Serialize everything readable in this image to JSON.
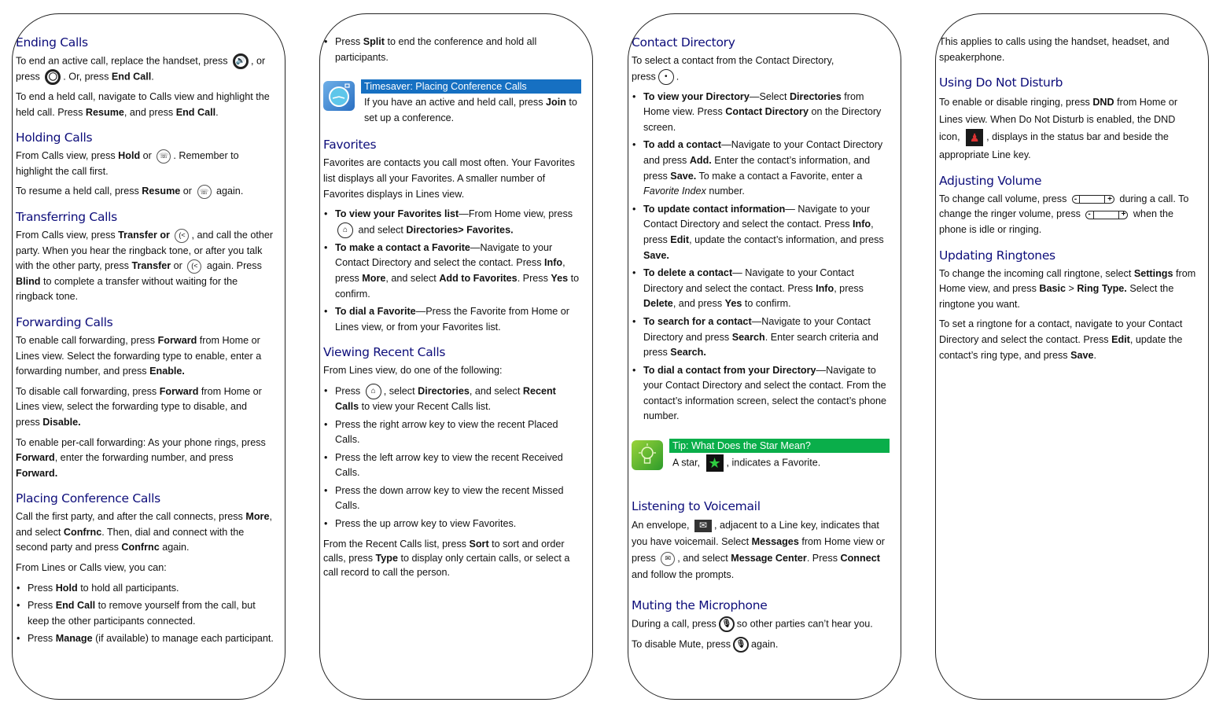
{
  "panel1": {
    "ending_calls": {
      "title": "Ending Calls",
      "p1_a": "To end an active call, replace the handset, press",
      "p1_b": ", or",
      "p1_c": "press",
      "p1_d": ". Or, press",
      "p1_bold1": "End Call",
      "p1_end": ".",
      "p2_a": "To end a held call, navigate to Calls view and highlight the held call. Press",
      "p2_bold1": "Resume",
      "p2_b": ", and press",
      "p2_bold2": "End Call",
      "p2_end": "."
    },
    "holding_calls": {
      "title": "Holding Calls",
      "p1_a": "From Calls view, press",
      "p1_bold": "Hold",
      "p1_b": "or",
      "p1_c": ". Remember to highlight the call first.",
      "p2_a": "To resume a held call, press",
      "p2_bold": "Resume",
      "p2_b": "or",
      "p2_c": "again."
    },
    "transferring_calls": {
      "title": "Transferring Calls",
      "a": "From Calls view, press",
      "bold1": "Transfer or",
      "b": ", and call the other party. When you hear the ringback tone, or after you talk with the other party, press",
      "bold2": "Transfer",
      "c": "or",
      "d": "again. Press",
      "bold3": "Blind",
      "e": "to complete a transfer without waiting for the ringback tone."
    },
    "forwarding_calls": {
      "title": "Forwarding Calls",
      "p1_a": "To enable call forwarding, press",
      "p1_bold1": "Forward",
      "p1_b": "from Home or Lines view. Select the forwarding type to enable, enter a forwarding number, and press",
      "p1_bold2": "Enable",
      "p2_a": "To disable call forwarding, press",
      "p2_bold1": "Forward",
      "p2_b": "from Home or Lines view, select the forwarding type to disable, and press",
      "p2_bold2": "Disable",
      "p3_a": "To enable per-call forwarding: As your phone rings, press",
      "p3_bold1": "Forward",
      "p3_b": ", enter the forwarding number, and press",
      "p3_bold2": "Forward",
      "period": "."
    },
    "conference_calls": {
      "title": "Placing Conference Calls",
      "p1_a": "Call the first party, and after the call connects, press",
      "p1_bold1": "More",
      "p1_b": ", and select",
      "p1_bold2": "Confrnc",
      "p1_c": ". Then, dial and connect with the second party and press",
      "p1_bold3": "Confrnc",
      "p1_d": "again.",
      "p2": "From Lines or Calls view, you can:",
      "items": [
        {
          "a": "Press",
          "bold": "Hold",
          "b": "to hold all participants."
        },
        {
          "a": "Press",
          "bold": "End Call",
          "b": "to remove yourself from the call, but keep the other participants connected."
        },
        {
          "a": "Press",
          "bold": "Manage",
          "b": "(if available) to manage each participant."
        }
      ]
    }
  },
  "panel2": {
    "split_item": {
      "a": "Press",
      "bold": "Split",
      "b": "to end the conference and hold all participants."
    },
    "timesaver": {
      "title": "Timesaver: Placing Conference Calls",
      "a": "If you have an active and held call, press",
      "bold": "Join",
      "b": "to set up a conference."
    },
    "favorites": {
      "title": "Favorites",
      "intro": "Favorites are contacts you call most often. Your Favorites list displays all your Favorites.  A smaller number of Favorites displays in Lines view.",
      "item1_bold": "To view your Favorites list",
      "item1_a": "—From Home view, press",
      "item1_b": "and select",
      "item1_bold2": "Directories> Favorites",
      "item2_bold": "To make a contact a Favorite",
      "item2_a": "—Navigate to your Contact Directory and select the contact. Press",
      "item2_bold2": "Info",
      "item2_b": ", press",
      "item2_bold3": "More",
      "item2_c": ", and select",
      "item2_bold4": "Add to Favorites",
      "item2_d": ".  Press",
      "item2_bold5": "Yes",
      "item2_e": "to confirm.",
      "item3_bold": "To dial a Favorite",
      "item3_a": "—Press the Favorite from Home or Lines view, or from your Favorites list."
    },
    "recent_calls": {
      "title": "Viewing Recent Calls",
      "intro": "From Lines view, do one of the following:",
      "item1_a": "Press",
      "item1_b": ", select",
      "item1_bold1": "Directories",
      "item1_c": ", and select",
      "item1_bold2": "Recent Calls",
      "item1_d": "to view your Recent Calls list.",
      "items": [
        "Press the right arrow key to view the recent Placed Calls.",
        "Press the left arrow key to view the recent Received Calls.",
        "Press the down arrow key to view the recent Missed Calls.",
        "Press the up arrow key to view Favorites."
      ],
      "outro_a": "From the Recent Calls list, press",
      "outro_bold1": "Sort",
      "outro_b": "to sort and order calls, press",
      "outro_bold2": "Type",
      "outro_c": "to display only certain calls, or select a call record to call the person."
    }
  },
  "panel3": {
    "contact_directory": {
      "title": "Contact Directory",
      "intro_a": "To select a contact from the Contact Directory,",
      "intro_b": "press",
      "intro_c": ".",
      "i1_bold": "To view your Directory",
      "i1_a": "—Select",
      "i1_bold2": "Directories",
      "i1_b": "from Home view. Press",
      "i1_bold3": "Contact Directory",
      "i1_c": "on the Directory screen.",
      "i2_bold": "To add a contact",
      "i2_a": "—Navigate to your Contact Directory and press",
      "i2_bold2": "Add.",
      "i2_b": "Enter the contact’s information, and press",
      "i2_bold3": "Save.",
      "i2_c": "To make a contact a Favorite, enter a",
      "i2_ital": "Favorite Index",
      "i2_d": "number.",
      "i3_bold": "To update contact information",
      "i3_a": "— Navigate to your Contact Directory and select the contact. Press",
      "i3_bold2": "Info",
      "i3_b": ", press",
      "i3_bold3": "Edit",
      "i3_c": ", update the contact’s information, and press",
      "i3_bold4": "Save",
      "i4_bold": "To delete a contact",
      "i4_a": "— Navigate to your Contact Directory and select the contact. Press",
      "i4_bold2": "Info",
      "i4_b": ", press",
      "i4_bold3": "Delete",
      "i4_c": ", and press",
      "i4_bold4": "Yes",
      "i4_d": "to confirm.",
      "i5_bold": "To search for a contact",
      "i5_a": "—Navigate to your Contact Directory and press",
      "i5_bold2": "Search",
      "i5_b": ". Enter search criteria and press",
      "i5_bold3": "Search",
      "i6_bold": "To dial a contact from your Directory",
      "i6_a": "—Navigate to your Contact Directory and select the contact. From the contact’s information screen, select the contact’s phone number.",
      "period": "."
    },
    "tip": {
      "title": "Tip: What Does the Star Mean?",
      "a": "A star,",
      "b": ", indicates a Favorite."
    },
    "voicemail": {
      "title": "Listening to Voicemail",
      "a": "An envelope,",
      "b": ", adjacent to a Line key, indicates that you have voicemail. Select",
      "bold1": "Messages",
      "c": "from Home view or press",
      "d": ", and select",
      "bold2": "Message Center",
      "e": ". Press",
      "bold3": "Connect",
      "f": "and follow the prompts."
    },
    "mute": {
      "title": "Muting the Microphone",
      "p1_a": "During a call, press",
      "p1_b": "so other parties can’t hear you.",
      "p2_a": "To disable Mute, press",
      "p2_b": "again."
    }
  },
  "panel4": {
    "intro": "This applies to calls using the handset, headset, and speakerphone.",
    "dnd": {
      "title": "Using Do Not Disturb",
      "a": "To enable or disable ringing, press",
      "bold": "DND",
      "b": "from Home or Lines view. When Do Not Disturb is enabled, the DND icon,",
      "c": ", displays in the status bar and beside the appropriate Line key."
    },
    "volume": {
      "title": "Adjusting Volume",
      "a": "To change call volume, press",
      "b": "during a call. To change the ringer volume, press",
      "c": "when the phone is idle or ringing."
    },
    "ringtones": {
      "title": "Updating Ringtones",
      "p1_a": "To change the incoming call ringtone, select",
      "p1_bold1": "Settings",
      "p1_b": "from Home view, and press",
      "p1_bold2": "Basic",
      "p1_gt": ">",
      "p1_bold3": "Ring Type.",
      "p1_c": "Select the ringtone you want.",
      "p2_a": "To set a ringtone for a contact, navigate to your Contact Directory and select the contact. Press",
      "p2_bold1": "Edit",
      "p2_b": ", update the contact’s ring type, and press",
      "p2_bold2": "Save",
      "period": "."
    }
  },
  "glyphs": {
    "speaker": "🔊",
    "headset": "◯",
    "hold": "☏",
    "transfer": "(<",
    "home": "⌂",
    "select": "•",
    "star": "★",
    "envelope": "✉",
    "messages": "✉",
    "mute": "🎙",
    "minus": "-",
    "plus": "+",
    "dnd": "♟"
  },
  "colors": {
    "heading": "#0d0d7a",
    "timesaver_bar": "#1670c2",
    "tip_bar": "#0aae4a",
    "star": "#2ecc40"
  }
}
